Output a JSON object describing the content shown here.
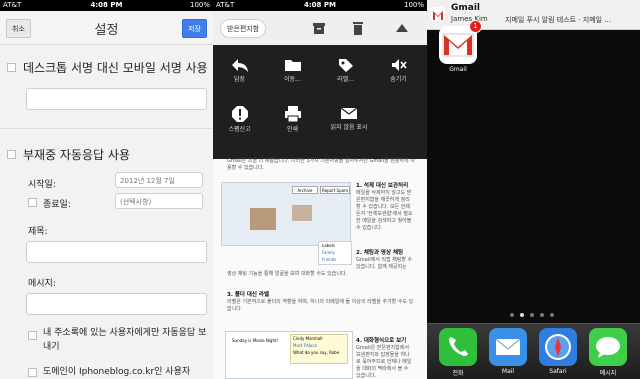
{
  "status": {
    "carrier": "AT&T",
    "time": "4:08 PM",
    "battery": "100%"
  },
  "settings": {
    "cancel_label": "취소",
    "title": "설정",
    "save_label": "저장",
    "mobile_signature_label": "데스크톱 서명 대신 모바일 서명 사용",
    "vacation_label": "부재중 자동응답 사용",
    "start_date_label": "시작일:",
    "start_date_value": "2012년 12월 7일",
    "end_date_label": "종료일:",
    "end_date_value": "(선택사항)",
    "subject_label": "제목:",
    "message_label": "메시지:",
    "contacts_only_label": "내 주소록에 있는 사용자에게만 자동응답 보내기",
    "domain_label": "도메인이 Iphoneblog.co.kr인 사용자"
  },
  "mail": {
    "archive_label": "받은편지함",
    "menu_items": [
      {
        "icon": "reply-icon",
        "label": "답장"
      },
      {
        "icon": "folder-icon",
        "label": "이동..."
      },
      {
        "icon": "label-icon",
        "label": "라벨..."
      },
      {
        "icon": "mute-icon",
        "label": "숨기기"
      },
      {
        "icon": "report-spam-icon",
        "label": "스팸신고"
      },
      {
        "icon": "print-icon",
        "label": "인쇄"
      },
      {
        "icon": "mark-unread-icon",
        "label": "읽지 않음 표시"
      }
    ],
    "doc_intro": "Gmail은 조금 더 새롭습니다. 이러한 3가지 기본사항을 알아두시면 Gmail을 원활하게 사용할 수 있습니다.",
    "section1_title": "1. 석제 대신 보관처리",
    "section1_body": "메일을 삭제하지 않고도 받은편지함을 깨끗하게 정리할 수 있습니다. 모든 언제든지 '전체보관함'에서 필요한 메일을 검색하고 찾아볼 수 있습니다.",
    "section2_title": "2. 채팅과 영상 채팅",
    "section2_body": "Gmail에서 직접 채팅할 수 있습니다. 함께 제공되는",
    "video_caption": "영상 채팅 기능을 통해 얼굴을 보며 대화할 수도 있습니다.",
    "section3_title": "3. 폴더 대신 라벨",
    "section3_body": "라벨은 기본적으로 폴더의 역할을 하며, 하나의 이메일에 둘 이상의 라벨을 추가할 수도 있습니다.",
    "section4_title": "4. 대화형식으로 보기",
    "section4_body": "Gmail은 받은편지함에서 보낸편지와 답장들을 하나로 묶어주므로 언제나 메일을 대화의 맥락에서 볼 수 있습니다.",
    "shot_buttons": [
      "Archive",
      "Report Spam"
    ],
    "shot_labels": [
      "Labels",
      "Family",
      "Friends"
    ],
    "chat_names": [
      "Cindy Marshall",
      "Mark Palace",
      "What do you say, Robe"
    ],
    "chat_sub": "Sunday is Movie Night!"
  },
  "home": {
    "notif_app": "Gmail",
    "notif_sender": "James Kim",
    "notif_text": "지메일 푸시 알림 테스트 · 지메일 ...",
    "gmail_label": "Gmail",
    "badge": "1",
    "dock": [
      {
        "icon": "phone-icon",
        "label": "전화",
        "color": "#2fbf3a"
      },
      {
        "icon": "mail-icon",
        "label": "Mail",
        "color": "#3a8fe6"
      },
      {
        "icon": "safari-icon",
        "label": "Safari",
        "color": "#2f7de0"
      },
      {
        "icon": "messages-icon",
        "label": "메시지",
        "color": "#3fcf4a"
      }
    ]
  }
}
